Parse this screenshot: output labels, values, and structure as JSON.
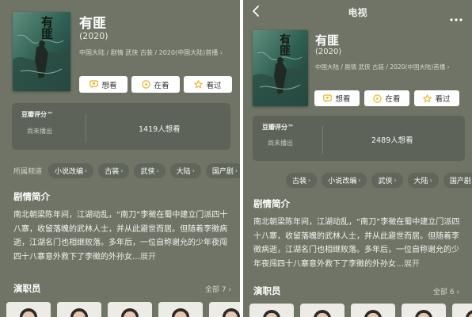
{
  "left": {
    "movie": {
      "poster_title": "有匪",
      "title": "有匪",
      "year": "(2020)",
      "meta": "中国大陆 / 剧情 武侠 古装 / 2020(中国大陆)首播 ›"
    },
    "actions": [
      {
        "label": "想看",
        "icon": "heart-chat-icon"
      },
      {
        "label": "在看",
        "icon": "play-circle-icon"
      },
      {
        "label": "看过",
        "icon": "star-icon"
      }
    ],
    "rating": {
      "label": "豆瓣评分™",
      "status": "尚未播出",
      "count": "1419人想看"
    },
    "channels": {
      "label": "所属频道",
      "items": [
        {
          "label": "小说改编",
          "arrow": "›"
        },
        {
          "label": "古装",
          "arrow": "›"
        },
        {
          "label": "武侠",
          "arrow": "›"
        },
        {
          "label": "大陆",
          "arrow": "›"
        },
        {
          "label": "国产剧",
          "arrow": "›"
        }
      ]
    },
    "synopsis": {
      "title": "剧情简介",
      "text": "南北朝梁陈年间，江湖动乱，“南刀”李徵在蜀中建立门派四十八寨，收留落魄的武林人士，并从此避世而居。但随着李徵病逝，江湖名门也相继败落。多年后，一位自称谢允的少年夜闯四十八寨意外救下了李徵的外孙女…",
      "expand": "展开"
    },
    "cast": {
      "title": "演职员",
      "all": "全部 7 ›"
    }
  },
  "right": {
    "nav": {
      "title": "电视"
    },
    "movie": {
      "poster_title": "有匪",
      "title": "有匪",
      "year": "(2020)",
      "meta": "中国大陆 / 剧情 武侠 古装 / 2020(中国大陆)首播 ›"
    },
    "actions": [
      {
        "label": "想看",
        "icon": "heart-chat-icon"
      },
      {
        "label": "在看",
        "icon": "play-circle-icon"
      },
      {
        "label": "看过",
        "icon": "star-icon"
      }
    ],
    "rating": {
      "label": "豆瓣评分™",
      "status": "尚未播出",
      "count": "2489人想看"
    },
    "channels": {
      "items": [
        {
          "label": "古装",
          "arrow": "›"
        },
        {
          "label": "小说改编",
          "arrow": "›"
        },
        {
          "label": "武侠",
          "arrow": "›"
        },
        {
          "label": "大陆",
          "arrow": "›"
        },
        {
          "label": "国产剧",
          "arrow": "›"
        }
      ]
    },
    "synopsis": {
      "title": "剧情简介",
      "text": "南北朝梁陈年间，江湖动乱，“南刀”李徵在蜀中建立门派四十八寨，收留落魄的武林人士，并从此避世而居。但随着李徵病逝，江湖名门也相继败落。多年后，一位自称谢允的少年夜闯四十八寨意外救下了李徵的外孙女…",
      "expand": "展开"
    },
    "cast": {
      "title": "演职员",
      "all": "全部 6 ›"
    }
  },
  "colors": {
    "page_background": "#6f7467",
    "rating_box": "#5d6358",
    "chip": "#60665b",
    "button": "#ffffff",
    "button_icon": "#e6b422"
  }
}
